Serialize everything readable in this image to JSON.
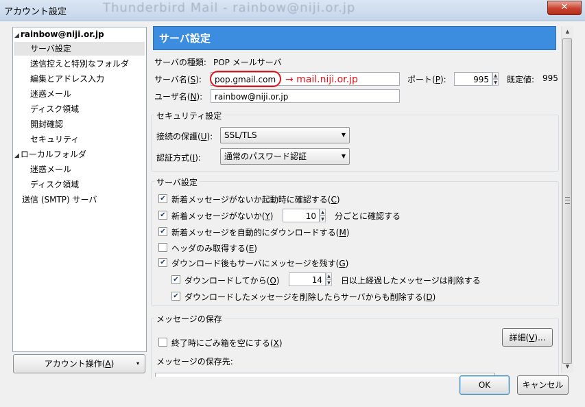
{
  "window": {
    "title": "アカウント設定",
    "ghost_title": "Thunderbird Mail - rainbow@niji.or.jp",
    "close_label": "✕"
  },
  "tree": {
    "items": [
      {
        "label": "rainbow@niji.or.jp",
        "level": 0,
        "expander": true
      },
      {
        "label": "サーバ設定",
        "level": 1,
        "selected": true
      },
      {
        "label": "送信控えと特別なフォルダ",
        "level": 1
      },
      {
        "label": "編集とアドレス入力",
        "level": 1
      },
      {
        "label": "迷惑メール",
        "level": 1
      },
      {
        "label": "ディスク領域",
        "level": 1
      },
      {
        "label": "開封確認",
        "level": 1
      },
      {
        "label": "セキュリティ",
        "level": 1
      },
      {
        "label": "ローカルフォルダ",
        "level": 0,
        "expander": true
      },
      {
        "label": "迷惑メール",
        "level": 1
      },
      {
        "label": "ディスク領域",
        "level": 1
      },
      {
        "label": "送信 (SMTP) サーバ",
        "level": 0
      }
    ],
    "account_actions": "アカウント操作(",
    "account_actions_key": "A",
    "account_actions_end": ")"
  },
  "panel": {
    "header": "サーバ設定",
    "server_type_label": "サーバの種類:",
    "server_type_value": "POP メールサーバ",
    "server_name_label": "サーバ名(",
    "server_name_key": "S",
    "server_name_end": "):",
    "server_name_value": "pop.gmail.com",
    "annotation": "→ mail.niji.or.jp",
    "port_label": "ポート(",
    "port_key": "P",
    "port_end": "):",
    "port_value": "995",
    "default_label": "既定値:",
    "default_value": "995",
    "user_label": "ユーザ名(",
    "user_key": "N",
    "user_end": "):",
    "user_value": "rainbow@niji.or.jp"
  },
  "security": {
    "title": "セキュリティ設定",
    "conn_label": "接続の保護(",
    "conn_key": "U",
    "conn_end": "):",
    "conn_value": "SSL/TLS",
    "auth_label": "認証方式(",
    "auth_key": "I",
    "auth_end": "):",
    "auth_value": "通常のパスワード認証"
  },
  "server_settings": {
    "title": "サーバ設定",
    "opt1": "新着メッセージがないか起動時に確認する(",
    "opt1_key": "C",
    "opt2": "新着メッセージがないか(",
    "opt2_key": "Y",
    "opt2_value": "10",
    "opt2_suffix": "分ごとに確認する",
    "opt3": "新着メッセージを自動的にダウンロードする(",
    "opt3_key": "M",
    "opt4": "ヘッダのみ取得する(",
    "opt4_key": "E",
    "opt5": "ダウンロード後もサーバにメッセージを残す(",
    "opt5_key": "G",
    "opt6": "ダウンロードしてから(",
    "opt6_key": "O",
    "opt6_value": "14",
    "opt6_suffix": "日以上経過したメッセージは削除する",
    "opt7": "ダウンロードしたメッセージを削除したらサーバからも削除する(",
    "opt7_key": "D",
    "close_paren": ")"
  },
  "storage": {
    "title": "メッセージの保存",
    "empty_trash": "終了時にごみ箱を空にする(",
    "empty_trash_key": "X",
    "details": "詳細(",
    "details_key": "V",
    "details_end": ")...",
    "store_label": "メッセージの保存先:"
  },
  "footer": {
    "ok": "OK",
    "cancel": "キャンセル"
  },
  "check": "✔"
}
